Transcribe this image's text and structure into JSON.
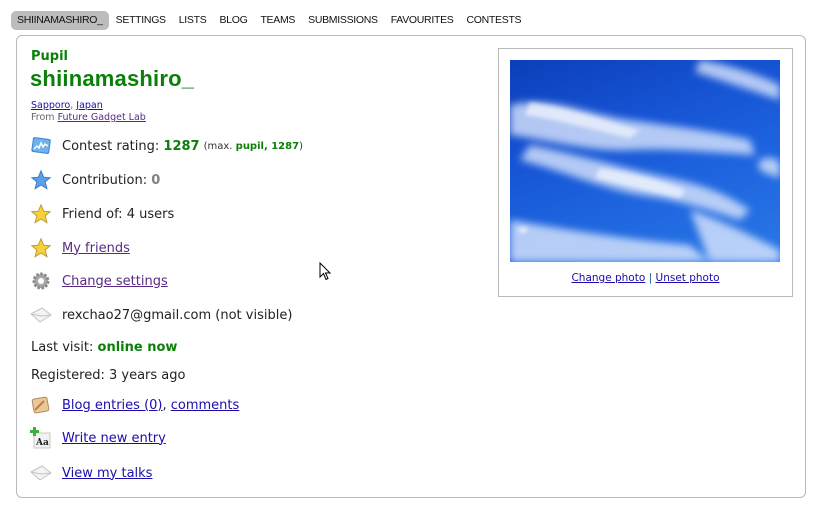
{
  "nav": {
    "tabs": [
      {
        "label": "SHIINAMASHIRO_",
        "active": true
      },
      {
        "label": "SETTINGS",
        "active": false
      },
      {
        "label": "LISTS",
        "active": false
      },
      {
        "label": "BLOG",
        "active": false
      },
      {
        "label": "TEAMS",
        "active": false
      },
      {
        "label": "SUBMISSIONS",
        "active": false
      },
      {
        "label": "FAVOURITES",
        "active": false
      },
      {
        "label": "CONTESTS",
        "active": false
      }
    ]
  },
  "profile": {
    "rank": "Pupil",
    "handle": "shiinamashiro_",
    "city": "Sapporo",
    "country": "Japan",
    "from_label": "From",
    "organization": "Future Gadget Lab",
    "rating_label": "Contest rating:",
    "rating": "1287",
    "max_prefix": "(max.",
    "max_rank": "pupil, 1287",
    "max_suffix": ")",
    "contribution_label": "Contribution:",
    "contribution": "0",
    "friend_of": "Friend of: 4 users",
    "my_friends": "My friends",
    "change_settings": "Change settings",
    "email": "rexchao27@gmail.com (not visible)",
    "last_visit_label": "Last visit:",
    "last_visit": "online now",
    "registered": "Registered: 3 years ago",
    "blog_entries": "Blog entries (0)",
    "comments": "comments",
    "write_entry": "Write new entry",
    "view_talks": "View my talks"
  },
  "photo": {
    "change": "Change photo",
    "separator": "|",
    "unset": "Unset photo"
  },
  "colors": {
    "rank_green": "#0a8008",
    "link": "#1a0dab",
    "visited": "#5a2a82",
    "tab_active_bg": "#bdbdbd"
  }
}
